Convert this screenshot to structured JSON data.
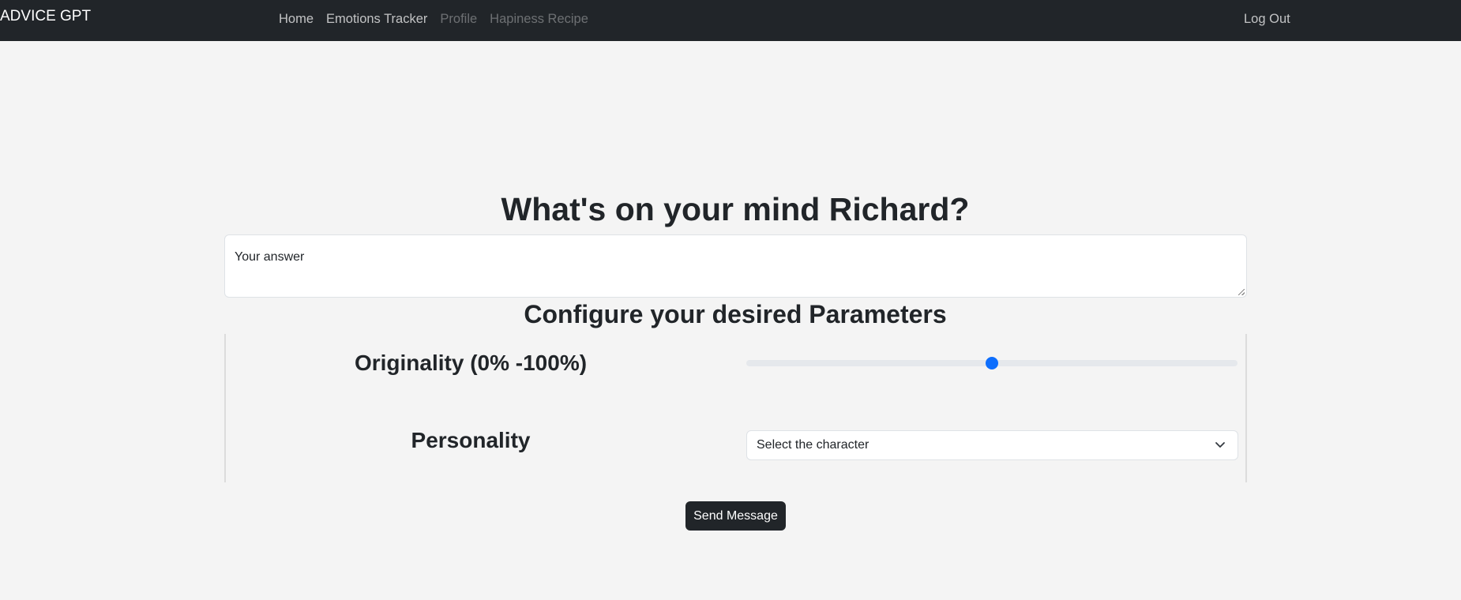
{
  "navbar": {
    "brand": "ADVICE GPT",
    "links": [
      {
        "label": "Home",
        "disabled": false
      },
      {
        "label": "Emotions Tracker",
        "disabled": false
      },
      {
        "label": "Profile",
        "disabled": true
      },
      {
        "label": "Hapiness Recipe",
        "disabled": true
      }
    ],
    "logout_label": "Log Out"
  },
  "main": {
    "heading": "What's on your mind Richard?",
    "answer_placeholder": "Your answer",
    "parameters_heading": "Configure your desired Parameters",
    "originality": {
      "label": "Originality (0% -100%)",
      "value": 50
    },
    "personality": {
      "label": "Personality",
      "selected": "Select the character"
    },
    "send_label": "Send Message"
  },
  "colors": {
    "navbar_bg": "#212529",
    "page_bg": "#f4f4f4",
    "slider_accent": "#0d6efd"
  },
  "icons": {
    "select_arrow": "chevron-down-icon"
  }
}
